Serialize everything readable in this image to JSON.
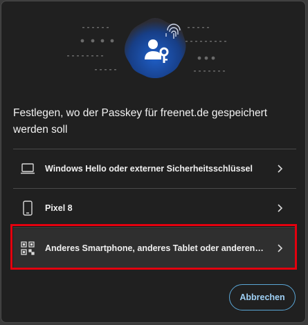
{
  "dialog": {
    "title": "Festlegen, wo der Passkey für freenet.de gespeichert werden soll",
    "options": [
      {
        "label": "Windows Hello oder externer Sicherheitsschlüssel",
        "icon": "laptop-icon"
      },
      {
        "label": "Pixel 8",
        "icon": "phone-icon"
      },
      {
        "label": "Anderes Smartphone, anderes Tablet oder anderen Sicherheitsschlüssel verwenden",
        "icon": "qr-code-icon",
        "selected": true
      }
    ],
    "cancel_label": "Abbrechen"
  },
  "colors": {
    "background": "#202020",
    "accent": "#5aa6d6",
    "hero_badge": "#1b4fa8",
    "highlight": "#e3000e"
  }
}
